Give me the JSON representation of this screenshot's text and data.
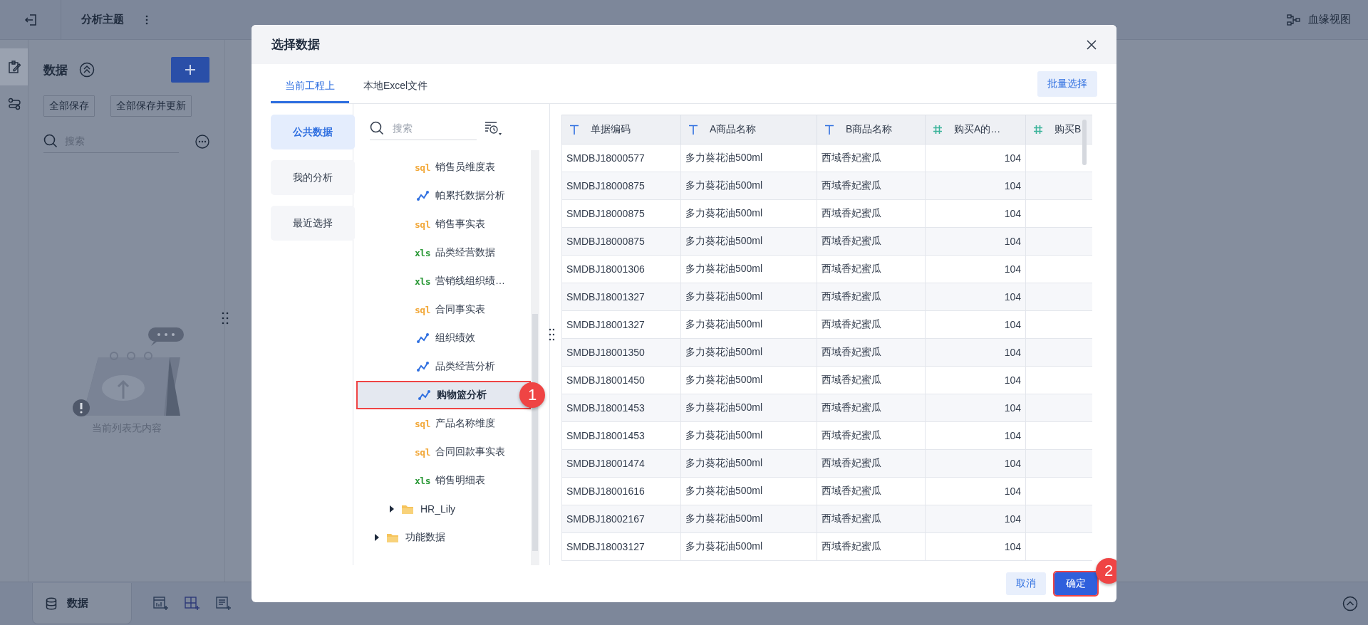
{
  "topbar": {
    "title": "分析主题",
    "lineage_link": "血缘视图"
  },
  "rail": [
    {
      "kind": "edit",
      "selected": true
    },
    {
      "kind": "flow",
      "selected": false
    }
  ],
  "data_panel": {
    "title": "数据",
    "buttons": [
      "全部保存",
      "全部保存并更新"
    ],
    "search": {
      "placeholder": "搜索"
    },
    "empty_text": "当前列表无内容"
  },
  "bottom_bar": {
    "tabs": [
      {
        "label": "数据",
        "selected": true
      }
    ]
  },
  "dialog": {
    "title": "选择数据",
    "tabs": [
      {
        "label": "当前工程上",
        "selected": true
      },
      {
        "label": "本地Excel文件",
        "selected": false
      }
    ],
    "batch_button": "批量选择",
    "nav": [
      {
        "label": "公共数据",
        "selected": true
      },
      {
        "label": "我的分析",
        "selected": false
      },
      {
        "label": "最近选择",
        "selected": false
      }
    ],
    "search": {
      "placeholder": "搜索"
    },
    "tree": [
      {
        "children": [
          {
            "children": [
              {
                "label": "销售员维度表",
                "kind": "sql",
                "icon_text": "sql",
                "selected": false
              },
              {
                "label": "帕累托数据分析",
                "kind": "analysis",
                "selected": false
              },
              {
                "label": "销售事实表",
                "kind": "sql",
                "icon_text": "sql",
                "selected": false
              },
              {
                "label": "品类经营数据",
                "kind": "xls",
                "icon_text": "xls",
                "selected": false
              },
              {
                "label": "营销线组织绩…",
                "kind": "xls",
                "icon_text": "xls",
                "selected": false
              },
              {
                "label": "合同事实表",
                "kind": "sql",
                "icon_text": "sql",
                "selected": false
              },
              {
                "label": "组织绩效",
                "kind": "analysis",
                "selected": false
              },
              {
                "label": "品类经营分析",
                "kind": "analysis",
                "selected": false
              },
              {
                "label": "购物篮分析",
                "kind": "analysis",
                "selected": true,
                "callout": "1"
              },
              {
                "label": "产品名称维度",
                "kind": "sql",
                "icon_text": "sql",
                "selected": false
              },
              {
                "label": "合同回款事实表",
                "kind": "sql",
                "icon_text": "sql",
                "selected": false
              },
              {
                "label": "销售明细表",
                "kind": "xls",
                "icon_text": "xls",
                "selected": false
              }
            ]
          },
          {
            "label": "HR_Lily",
            "kind": "folder",
            "expanded": false
          }
        ]
      },
      {
        "label": "功能数据",
        "kind": "folder",
        "expanded": false
      }
    ],
    "table": {
      "columns": [
        {
          "label": "单据编码",
          "kind": "text"
        },
        {
          "label": "A商品名称",
          "kind": "text"
        },
        {
          "label": "B商品名称",
          "kind": "text"
        },
        {
          "label": "购买A的…",
          "kind": "number"
        },
        {
          "label": "购买B",
          "kind": "number"
        }
      ],
      "rows": [
        [
          "SMDBJ18000577",
          "多力葵花油500ml",
          "西域香妃蜜瓜",
          "104"
        ],
        [
          "SMDBJ18000875",
          "多力葵花油500ml",
          "西域香妃蜜瓜",
          "104"
        ],
        [
          "SMDBJ18000875",
          "多力葵花油500ml",
          "西域香妃蜜瓜",
          "104"
        ],
        [
          "SMDBJ18000875",
          "多力葵花油500ml",
          "西域香妃蜜瓜",
          "104"
        ],
        [
          "SMDBJ18001306",
          "多力葵花油500ml",
          "西域香妃蜜瓜",
          "104"
        ],
        [
          "SMDBJ18001327",
          "多力葵花油500ml",
          "西域香妃蜜瓜",
          "104"
        ],
        [
          "SMDBJ18001327",
          "多力葵花油500ml",
          "西域香妃蜜瓜",
          "104"
        ],
        [
          "SMDBJ18001350",
          "多力葵花油500ml",
          "西域香妃蜜瓜",
          "104"
        ],
        [
          "SMDBJ18001450",
          "多力葵花油500ml",
          "西域香妃蜜瓜",
          "104"
        ],
        [
          "SMDBJ18001453",
          "多力葵花油500ml",
          "西域香妃蜜瓜",
          "104"
        ],
        [
          "SMDBJ18001453",
          "多力葵花油500ml",
          "西域香妃蜜瓜",
          "104"
        ],
        [
          "SMDBJ18001474",
          "多力葵花油500ml",
          "西域香妃蜜瓜",
          "104"
        ],
        [
          "SMDBJ18001616",
          "多力葵花油500ml",
          "西域香妃蜜瓜",
          "104"
        ],
        [
          "SMDBJ18002167",
          "多力葵花油500ml",
          "西域香妃蜜瓜",
          "104"
        ],
        [
          "SMDBJ18003127",
          "多力葵花油500ml",
          "西域香妃蜜瓜",
          "104"
        ]
      ]
    },
    "buttons": [
      {
        "label": "取消",
        "kind": "secondary"
      },
      {
        "label": "确定",
        "kind": "primary",
        "callout": "2"
      }
    ]
  }
}
